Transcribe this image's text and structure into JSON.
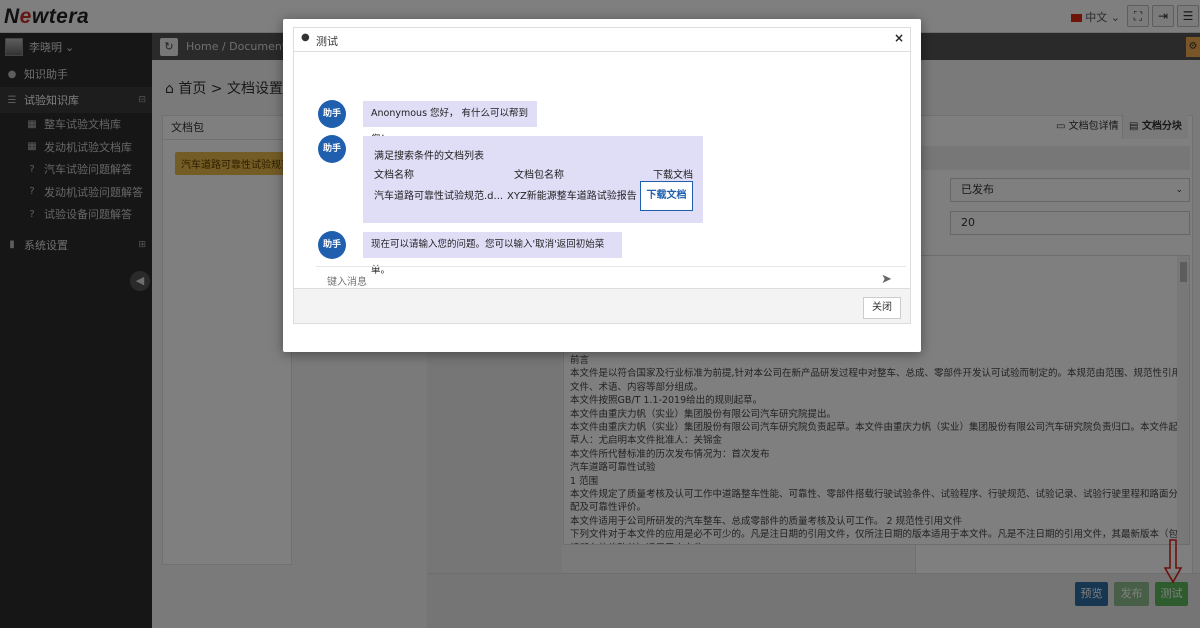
{
  "topbar": {
    "logo_pre": "N",
    "logo_o": "e",
    "logo_post": "wtera",
    "language": "中文",
    "language_caret": "⌄"
  },
  "sidebar": {
    "user_name": "李晓明",
    "user_caret": "⌄",
    "items": [
      {
        "label": "知识助手",
        "icon": "user-icon"
      },
      {
        "label": "试验知识库",
        "icon": "list-icon",
        "expand": "⊟"
      },
      {
        "label": "整车试验文档库",
        "icon": "doc-icon"
      },
      {
        "label": "发动机试验文档库",
        "icon": "doc-icon"
      },
      {
        "label": "汽车试验问题解答",
        "icon": "question-icon"
      },
      {
        "label": "发动机试验问题解答",
        "icon": "question-icon"
      },
      {
        "label": "试验设备问题解答",
        "icon": "question-icon"
      },
      {
        "label": "系统设置",
        "icon": "settings-icon",
        "expand": "⊞"
      }
    ]
  },
  "content": {
    "crumb_tab": "Home / Document Ma",
    "page_title": "首页 > 文档设置",
    "left_panel_header": "文档包",
    "left_tag": "汽车道路可靠性试验规范",
    "right_tabs": [
      "文档包详情",
      "文档分块"
    ],
    "status_select": "已发布",
    "number_value": "20",
    "colon": ":",
    "doc_lines": [
      "前言",
      "本文件是以符合国家及行业标准为前提,针对本公司在新产品研发过程中对整车、总成、零部件开发认可试验而制定的。本规范由范围、规范性引用",
      "文件、术语、内容等部分组成。",
      "本文件按照GB/T 1.1-2019给出的规则起草。",
      "本文件由重庆力帆（实业）集团股份有限公司汽车研究院提出。",
      "本文件由重庆力帆（实业）集团股份有限公司汽车研究院负责起草。本文件由重庆力帆（实业）集团股份有限公司汽车研究院负责归口。本文件起",
      "草人：尤启明本文件批准人：关锦金",
      "本文件所代替标准的历次发布情况为：首次发布",
      "汽车道路可靠性试验",
      "1 范围",
      "本文件规定了质量考核及认可工作中道路整车性能、可靠性、零部件搭载行驶试验条件、试验程序、行驶规范、试验记录、试验行驶里程和路面分",
      "配及可靠性评价。",
      "本文件适用于公司所研发的汽车整车、总成零部件的质量考核及认可工作。 2 规范性引用文件",
      "下列文件对于本文件的应用是必不可少的。凡是注日期的引用文件，仅所注日期的版本适用于本文件。凡是不注日期的引用文件，其最新版本（包",
      "括所有的修改单）适用于本文件。"
    ],
    "footer_buttons": [
      "预览",
      "发布",
      "测试"
    ]
  },
  "modal": {
    "title": "测试",
    "close_x": "×",
    "bot_name": "助手",
    "msg1": "Anonymous 您好， 有什么可以帮到您！",
    "msg2_caption": "满足搜索条件的文档列表",
    "msg2_columns": [
      "文档名称",
      "文档包名称",
      "下载文档"
    ],
    "msg2_row": {
      "doc_name": "汽车道路可靠性试验规范.d...",
      "package_name": "XYZ新能源整车道路试验报告",
      "download": "下载文档"
    },
    "msg3": "现在可以请输入您的问题。您可以输入'取消'返回初始菜单。",
    "input_placeholder": "键入消息",
    "close_button": "关闭"
  },
  "colors": {
    "sidebar_bg": "#2d2d2d",
    "bot_avatar": "#1f5fae",
    "bubble_bg": "#e0ddf7",
    "preview_btn": "#2e6da4",
    "publish_btn": "#8fbc8f",
    "test_btn": "#5cb85c",
    "arrow": "#d9241c"
  }
}
